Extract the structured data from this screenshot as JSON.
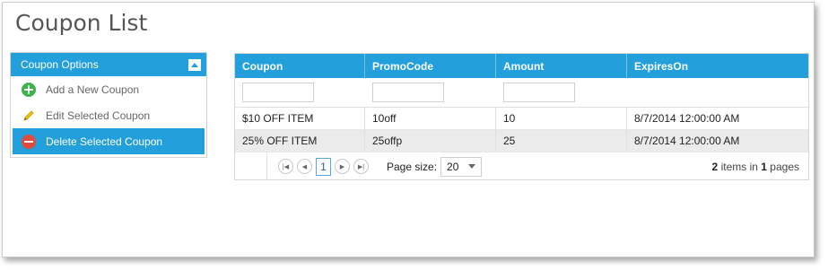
{
  "page": {
    "title": "Coupon List"
  },
  "options_panel": {
    "header": "Coupon Options",
    "items": [
      {
        "label": "Add a New Coupon",
        "icon": "add-circle-icon",
        "active": false
      },
      {
        "label": "Edit Selected Coupon",
        "icon": "pencil-icon",
        "active": false
      },
      {
        "label": "Delete Selected Coupon",
        "icon": "delete-circle-icon",
        "active": true
      }
    ]
  },
  "grid": {
    "columns": [
      "Coupon",
      "PromoCode",
      "Amount",
      "ExpiresOn"
    ],
    "rows": [
      [
        "$10 OFF ITEM",
        "10off",
        "10",
        "8/7/2014 12:00:00 AM"
      ],
      [
        "25% OFF ITEM",
        "25offp",
        "25",
        "8/7/2014 12:00:00 AM"
      ]
    ],
    "pager": {
      "current_page": "1",
      "page_size_label": "Page size:",
      "page_size": "20",
      "item_count": "2",
      "items_in_text": "items in",
      "page_count": "1",
      "pages_text": "pages"
    }
  },
  "colors": {
    "accent": "#23a0dc",
    "alt_row": "#ebebeb"
  }
}
